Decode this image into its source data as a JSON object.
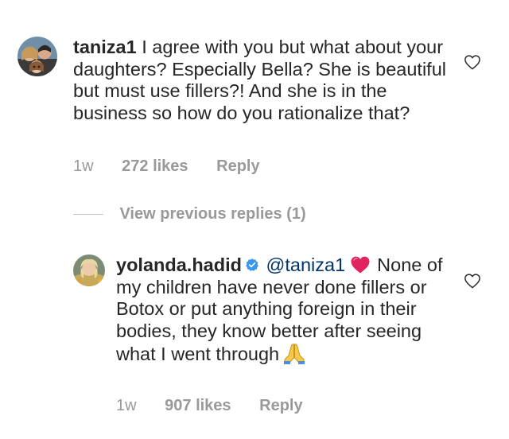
{
  "comment1": {
    "username": "taniza1",
    "text": "I agree with you but what about your daughters?  Especially Bella?  She is beautiful but must use fillers?! And she is in the business so how do you rationalize that?",
    "time": "1w",
    "likes": "272 likes",
    "reply": "Reply",
    "icons": {
      "like": "heart-outline-icon",
      "avatar": "user-avatar"
    }
  },
  "view_previous": {
    "label": "View previous replies (1)"
  },
  "comment2": {
    "username": "yolanda.hadid",
    "mention": "@taniza1",
    "text": "None of my children have never done fillers or Botox or put anything foreign in their bodies, they know better after seeing what I went through",
    "time": "1w",
    "likes": "907 likes",
    "reply": "Reply",
    "icons": {
      "verified": "verified-badge-icon",
      "heart_emoji": "red-heart-emoji",
      "pray_emoji": "folded-hands-emoji",
      "like": "heart-outline-icon"
    }
  },
  "colors": {
    "text": "#262626",
    "muted": "#999999",
    "mention": "#003569",
    "verified": "#3897f0",
    "emoji_heart": "#e0245e"
  }
}
